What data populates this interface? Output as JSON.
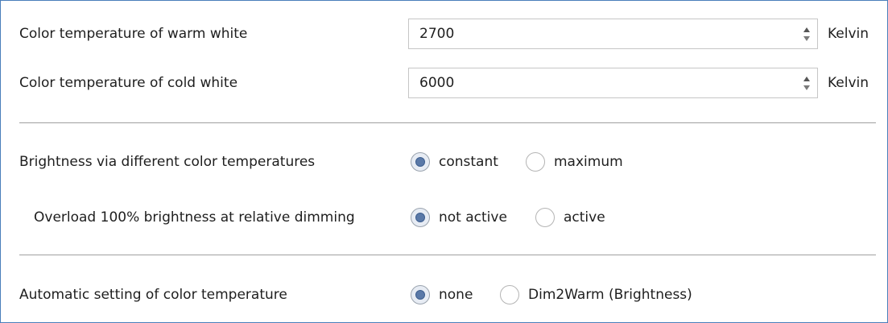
{
  "warm_white": {
    "label": "Color temperature of warm white",
    "value": "2700",
    "unit": "Kelvin"
  },
  "cold_white": {
    "label": "Color temperature of cold white",
    "value": "6000",
    "unit": "Kelvin"
  },
  "brightness": {
    "label": "Brightness via different color temperatures",
    "selected": "constant",
    "options": [
      "constant",
      "maximum"
    ]
  },
  "overload": {
    "label": "Overload 100% brightness at relative dimming",
    "selected": "not active",
    "options": [
      "not active",
      "active"
    ]
  },
  "automatic": {
    "label": "Automatic setting of color temperature",
    "selected": "none",
    "options": [
      "none",
      "Dim2Warm (Brightness)"
    ]
  },
  "colors": {
    "frame_border": "#4a7ebb",
    "radio_dot": "#5a79a8",
    "divider": "#a0a0a0"
  }
}
